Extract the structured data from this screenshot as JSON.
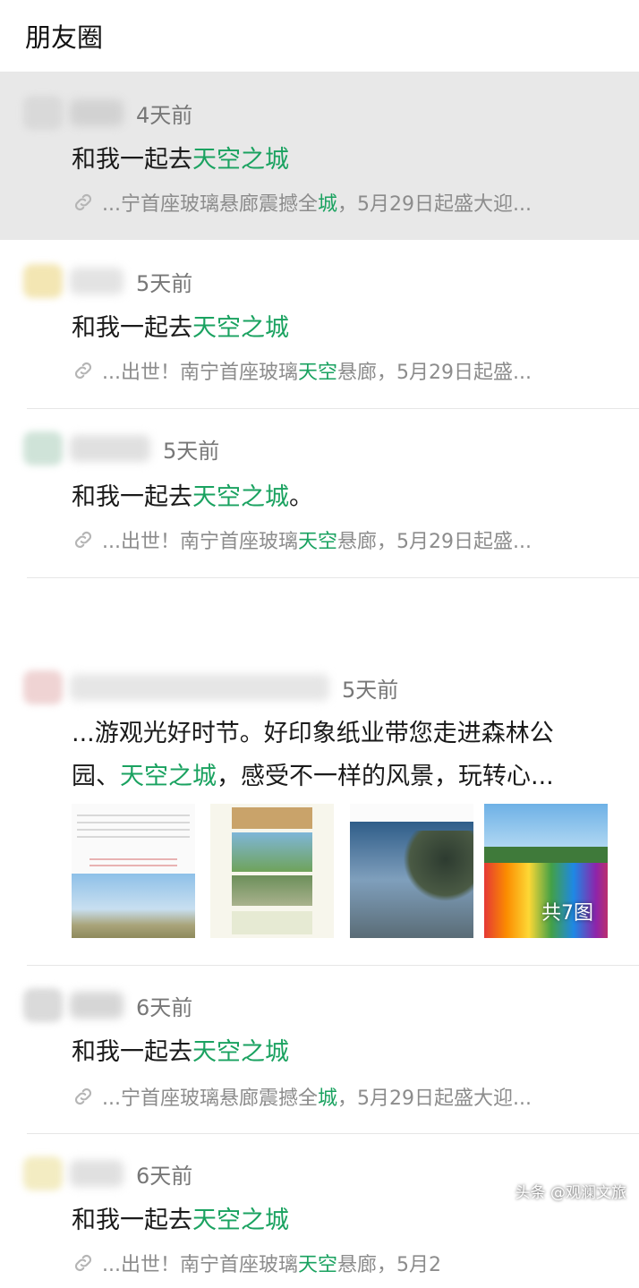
{
  "header": {
    "title": "朋友圈"
  },
  "posts": [
    {
      "time": "4天前",
      "title_pre": "和我一起去",
      "title_hl": "天空之城",
      "title_post": "",
      "link_pre": "...宁首座玻璃悬廊震撼全",
      "link_hl": "城",
      "link_post": "，5月29日起盛大迎..."
    },
    {
      "time": "5天前",
      "title_pre": "和我一起去",
      "title_hl": "天空之城",
      "title_post": "",
      "link_pre": "...出世！南宁首座玻璃",
      "link_hl": "天空",
      "link_post": "悬廊，5月29日起盛..."
    },
    {
      "time": "5天前",
      "title_pre": "和我一起去",
      "title_hl": "天空之城",
      "title_post": "。",
      "link_pre": "...出世！南宁首座玻璃",
      "link_hl": "天空",
      "link_post": "悬廊，5月29日起盛..."
    },
    {
      "time": "5天前",
      "body_line1": "...游观光好时节。好印象纸业带您走进森林公",
      "body_line2_pre": "园、",
      "body_line2_hl": "天空之城",
      "body_line2_post": "，感受不一样的风景，玩转心...",
      "image_count": "共7图"
    },
    {
      "time": "6天前",
      "title_pre": "和我一起去",
      "title_hl": "天空之城",
      "title_post": "",
      "link_pre": "...宁首座玻璃悬廊震撼全",
      "link_hl": "城",
      "link_post": "，5月29日起盛大迎..."
    },
    {
      "time": "6天前",
      "title_pre": "和我一起去",
      "title_hl": "天空之城",
      "title_post": "",
      "link_pre": "...出世！南宁首座玻璃",
      "link_hl": "天空",
      "link_post": "悬廊，5月2"
    }
  ],
  "watermark": {
    "text": "头条 @观澜文旅"
  },
  "colors": {
    "highlight": "#1aa260",
    "selected_bg": "#e8e8e8"
  }
}
